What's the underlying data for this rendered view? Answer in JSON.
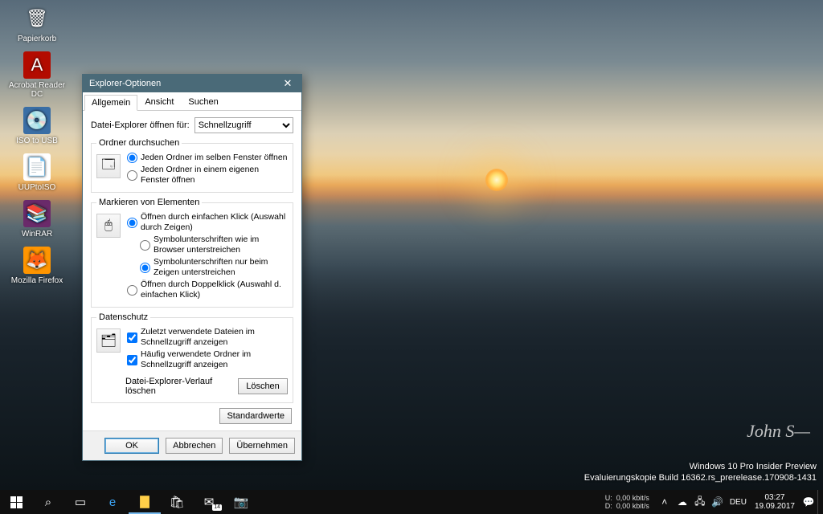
{
  "desktop_icons": [
    {
      "name": "papierkorb",
      "label": "Papierkorb",
      "glyph": "🗑",
      "bg": "transparent"
    },
    {
      "name": "acrobat",
      "label": "Acrobat Reader DC",
      "glyph": "A",
      "bg": "#b30b00"
    },
    {
      "name": "isotousb",
      "label": "ISO to USB",
      "glyph": "💿",
      "bg": "#3a6ea5"
    },
    {
      "name": "uuptoiso",
      "label": "UUPtoISO",
      "glyph": "📄",
      "bg": "#ffffff"
    },
    {
      "name": "winrar",
      "label": "WinRAR",
      "glyph": "📚",
      "bg": "#6a2a6a"
    },
    {
      "name": "firefox",
      "label": "Mozilla Firefox",
      "glyph": "🦊",
      "bg": "#ff9500"
    }
  ],
  "dialog": {
    "title": "Explorer-Optionen",
    "tabs": {
      "general": "Allgemein",
      "view": "Ansicht",
      "search": "Suchen"
    },
    "open_for_label": "Datei-Explorer öffnen für:",
    "open_for_value": "Schnellzugriff",
    "group_browse": {
      "legend": "Ordner durchsuchen",
      "opt_same": "Jeden Ordner im selben Fenster öffnen",
      "opt_own": "Jeden Ordner in einem eigenen Fenster öffnen"
    },
    "group_mark": {
      "legend": "Markieren von Elementen",
      "opt_single": "Öffnen durch einfachen Klick (Auswahl durch Zeigen)",
      "opt_ul_browser": "Symbolunterschriften wie im Browser unterstreichen",
      "opt_ul_point": "Symbolunterschriften nur beim Zeigen unterstreichen",
      "opt_double": "Öffnen durch Doppelklick (Auswahl d. einfachen Klick)"
    },
    "group_privacy": {
      "legend": "Datenschutz",
      "chk_recent": "Zuletzt verwendete Dateien im Schnellzugriff anzeigen",
      "chk_frequent": "Häufig verwendete Ordner im Schnellzugriff anzeigen",
      "clear_label": "Datei-Explorer-Verlauf löschen",
      "clear_btn": "Löschen"
    },
    "defaults_btn": "Standardwerte",
    "ok": "OK",
    "cancel": "Abbrechen",
    "apply": "Übernehmen"
  },
  "watermark": {
    "line1": "Windows 10 Pro Insider Preview",
    "line2": "Evaluierungskopie Build 16362.rs_prerelease.170908-1431"
  },
  "signature": "John S—",
  "taskbar": {
    "net": {
      "up_label": "U:",
      "down_label": "D:",
      "up": "0,00 kbit/s",
      "down": "0,00 kbit/s"
    },
    "lang": "DEU",
    "time": "03:27",
    "date": "19.09.2017",
    "mail_badge": "14"
  }
}
